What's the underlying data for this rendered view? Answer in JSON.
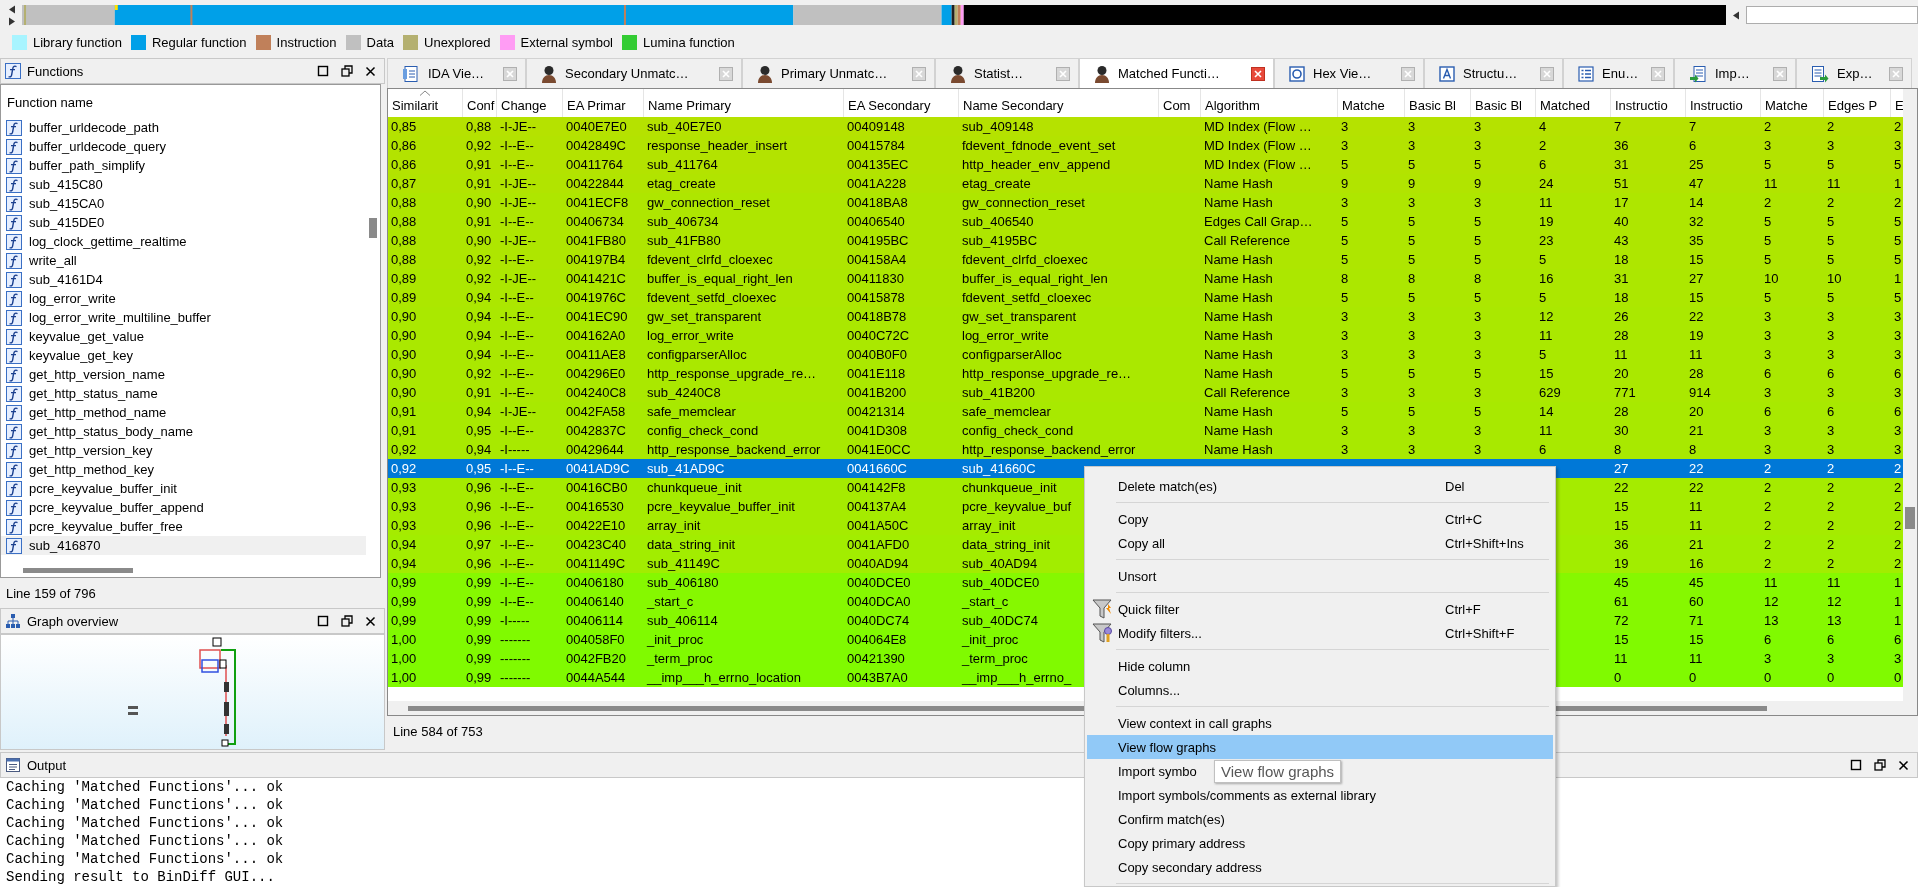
{
  "navigation_band": {
    "legend": [
      {
        "label": "Library function",
        "color": "#a8f4ff"
      },
      {
        "label": "Regular function",
        "color": "#00a0e8"
      },
      {
        "label": "Instruction",
        "color": "#c0805a"
      },
      {
        "label": "Data",
        "color": "#c0c0c0"
      },
      {
        "label": "Unexplored",
        "color": "#b4b070"
      },
      {
        "label": "External symbol",
        "color": "#ff9cf4"
      },
      {
        "label": "Lumina function",
        "color": "#33cc33"
      }
    ]
  },
  "functions_panel": {
    "title": "Functions",
    "column": "Function name",
    "items": [
      {
        "name": "buffer_urldecode_path",
        "selected": false
      },
      {
        "name": "buffer_urldecode_query",
        "selected": false
      },
      {
        "name": "buffer_path_simplify",
        "selected": false
      },
      {
        "name": "sub_415C80",
        "selected": false
      },
      {
        "name": "sub_415CA0",
        "selected": false
      },
      {
        "name": "sub_415DE0",
        "selected": false
      },
      {
        "name": "log_clock_gettime_realtime",
        "selected": false
      },
      {
        "name": "write_all",
        "selected": false
      },
      {
        "name": "sub_4161D4",
        "selected": false
      },
      {
        "name": "log_error_write",
        "selected": false
      },
      {
        "name": "log_error_write_multiline_buffer",
        "selected": false
      },
      {
        "name": "keyvalue_get_value",
        "selected": false
      },
      {
        "name": "keyvalue_get_key",
        "selected": false
      },
      {
        "name": "get_http_version_name",
        "selected": false
      },
      {
        "name": "get_http_status_name",
        "selected": false
      },
      {
        "name": "get_http_method_name",
        "selected": false
      },
      {
        "name": "get_http_status_body_name",
        "selected": false
      },
      {
        "name": "get_http_version_key",
        "selected": false
      },
      {
        "name": "get_http_method_key",
        "selected": false
      },
      {
        "name": "pcre_keyvalue_buffer_init",
        "selected": false
      },
      {
        "name": "pcre_keyvalue_buffer_append",
        "selected": false
      },
      {
        "name": "pcre_keyvalue_buffer_free",
        "selected": false
      },
      {
        "name": "sub_416870",
        "selected": true
      }
    ],
    "status": "Line 159 of 796"
  },
  "graph_overview": {
    "title": "Graph overview"
  },
  "tabs": [
    {
      "label": "IDA Vie…",
      "kind": "listing",
      "selected": false
    },
    {
      "label": "Secondary Unmatc…",
      "kind": "figure",
      "selected": false
    },
    {
      "label": "Primary Unmatc…",
      "kind": "figure",
      "selected": false
    },
    {
      "label": "Statist…",
      "kind": "figure",
      "selected": false
    },
    {
      "label": "Matched Functi…",
      "kind": "figure",
      "selected": true
    },
    {
      "label": "Hex Vie…",
      "kind": "hex",
      "selected": false
    },
    {
      "label": "Structu…",
      "kind": "struct",
      "selected": false
    },
    {
      "label": "Enu…",
      "kind": "enum",
      "selected": false
    },
    {
      "label": "Imp…",
      "kind": "import",
      "selected": false
    },
    {
      "label": "Exp…",
      "kind": "export",
      "selected": false
    }
  ],
  "table": {
    "columns": [
      {
        "label": "Similarit",
        "sorted": true
      },
      {
        "label": "Conf",
        "sorted": false
      },
      {
        "label": "Change",
        "sorted": false
      },
      {
        "label": "EA Primar",
        "sorted": false
      },
      {
        "label": "Name Primary",
        "sorted": false
      },
      {
        "label": "EA Secondary",
        "sorted": false
      },
      {
        "label": "Name Secondary",
        "sorted": false
      },
      {
        "label": "Com",
        "sorted": false
      },
      {
        "label": "Algorithm",
        "sorted": false
      },
      {
        "label": "Matche",
        "sorted": false
      },
      {
        "label": "Basic Bl",
        "sorted": false
      },
      {
        "label": "Basic Bl",
        "sorted": false
      },
      {
        "label": "Matched",
        "sorted": false
      },
      {
        "label": "Instructio",
        "sorted": false
      },
      {
        "label": "Instructio",
        "sorted": false
      },
      {
        "label": "Matche",
        "sorted": false
      },
      {
        "label": "Edges P",
        "sorted": false
      },
      {
        "label": "E",
        "sorted": false
      }
    ],
    "rows": [
      {
        "selected": false,
        "color": "#b5e200",
        "cells": [
          "0,85",
          "0,88",
          "-I-JE--",
          "0040E7E0",
          "sub_40E7E0",
          "00409148",
          "sub_409148",
          null,
          "MD Index (Flow …",
          "3",
          "3",
          "3",
          "4",
          "7",
          "7",
          "2",
          "2",
          "2"
        ]
      },
      {
        "selected": false,
        "color": "#b3e300",
        "cells": [
          "0,86",
          "0,92",
          "-I--E--",
          "0042849C",
          "response_header_insert",
          "00415784",
          "fdevent_fdnode_event_set",
          null,
          "MD Index (Flow …",
          "3",
          "3",
          "3",
          "2",
          "36",
          "6",
          "3",
          "3",
          "3"
        ]
      },
      {
        "selected": false,
        "color": "#b3e300",
        "cells": [
          "0,86",
          "0,91",
          "-I--E--",
          "00411764",
          "sub_411764",
          "004135EC",
          "http_header_env_append",
          null,
          "MD Index (Flow …",
          "5",
          "5",
          "5",
          "6",
          "31",
          "25",
          "5",
          "5",
          "5"
        ]
      },
      {
        "selected": false,
        "color": "#b1e400",
        "cells": [
          "0,87",
          "0,91",
          "-I-JE--",
          "00422844",
          "etag_create",
          "0041A228",
          "etag_create",
          null,
          "Name Hash",
          "9",
          "9",
          "9",
          "24",
          "51",
          "47",
          "11",
          "11",
          "1"
        ]
      },
      {
        "selected": false,
        "color": "#aee600",
        "cells": [
          "0,88",
          "0,90",
          "-I-JE--",
          "0041ECF8",
          "gw_connection_reset",
          "00418BA8",
          "gw_connection_reset",
          null,
          "Name Hash",
          "3",
          "3",
          "3",
          "11",
          "17",
          "14",
          "2",
          "2",
          "2"
        ]
      },
      {
        "selected": false,
        "color": "#aee600",
        "cells": [
          "0,88",
          "0,91",
          "-I--E--",
          "00406734",
          "sub_406734",
          "00406540",
          "sub_406540",
          null,
          "Edges Call Grap…",
          "5",
          "5",
          "5",
          "19",
          "40",
          "32",
          "5",
          "5",
          "5"
        ]
      },
      {
        "selected": false,
        "color": "#aee600",
        "cells": [
          "0,88",
          "0,90",
          "-I-JE--",
          "0041FB80",
          "sub_41FB80",
          "004195BC",
          "sub_4195BC",
          null,
          "Call Reference",
          "5",
          "5",
          "5",
          "23",
          "43",
          "35",
          "5",
          "5",
          "5"
        ]
      },
      {
        "selected": false,
        "color": "#aee600",
        "cells": [
          "0,88",
          "0,92",
          "-I--E--",
          "004197B4",
          "fdevent_clrfd_cloexec",
          "004158A4",
          "fdevent_clrfd_cloexec",
          null,
          "Name Hash",
          "5",
          "5",
          "5",
          "5",
          "18",
          "15",
          "5",
          "5",
          "5"
        ]
      },
      {
        "selected": false,
        "color": "#ace700",
        "cells": [
          "0,89",
          "0,92",
          "-I-JE--",
          "0041421C",
          "buffer_is_equal_right_len",
          "00411830",
          "buffer_is_equal_right_len",
          null,
          "Name Hash",
          "8",
          "8",
          "8",
          "16",
          "31",
          "27",
          "10",
          "10",
          "1"
        ]
      },
      {
        "selected": false,
        "color": "#ace700",
        "cells": [
          "0,89",
          "0,94",
          "-I--E--",
          "0041976C",
          "fdevent_setfd_cloexec",
          "00415878",
          "fdevent_setfd_cloexec",
          null,
          "Name Hash",
          "5",
          "5",
          "5",
          "5",
          "18",
          "15",
          "5",
          "5",
          "5"
        ]
      },
      {
        "selected": false,
        "color": "#aae800",
        "cells": [
          "0,90",
          "0,94",
          "-I--E--",
          "0041EC90",
          "gw_set_transparent",
          "00418B78",
          "gw_set_transparent",
          null,
          "Name Hash",
          "3",
          "3",
          "3",
          "12",
          "26",
          "22",
          "3",
          "3",
          "3"
        ]
      },
      {
        "selected": false,
        "color": "#aae800",
        "cells": [
          "0,90",
          "0,94",
          "-I--E--",
          "004162A0",
          "log_error_write",
          "0040C72C",
          "log_error_write",
          null,
          "Name Hash",
          "3",
          "3",
          "3",
          "11",
          "28",
          "19",
          "3",
          "3",
          "3"
        ]
      },
      {
        "selected": false,
        "color": "#aae800",
        "cells": [
          "0,90",
          "0,94",
          "-I--E--",
          "00411AE8",
          "configparserAlloc",
          "0040B0F0",
          "configparserAlloc",
          null,
          "Name Hash",
          "3",
          "3",
          "3",
          "5",
          "11",
          "11",
          "3",
          "3",
          "3"
        ]
      },
      {
        "selected": false,
        "color": "#aae800",
        "cells": [
          "0,90",
          "0,92",
          "-I--E--",
          "004296E0",
          "http_response_upgrade_re…",
          "0041E118",
          "http_response_upgrade_re…",
          null,
          "Name Hash",
          "5",
          "5",
          "5",
          "15",
          "20",
          "28",
          "6",
          "6",
          "6"
        ]
      },
      {
        "selected": false,
        "color": "#aae800",
        "cells": [
          "0,90",
          "0,91",
          "-I--E--",
          "004240C8",
          "sub_4240C8",
          "0041B200",
          "sub_41B200",
          null,
          "Call Reference",
          "3",
          "3",
          "3",
          "629",
          "771",
          "914",
          "3",
          "3",
          "3"
        ]
      },
      {
        "selected": false,
        "color": "#a8e900",
        "cells": [
          "0,91",
          "0,94",
          "-I-JE--",
          "0042FA58",
          "safe_memclear",
          "00421314",
          "safe_memclear",
          null,
          "Name Hash",
          "5",
          "5",
          "5",
          "14",
          "28",
          "20",
          "6",
          "6",
          "6"
        ]
      },
      {
        "selected": false,
        "color": "#a8e900",
        "cells": [
          "0,91",
          "0,95",
          "-I--E--",
          "0042837C",
          "config_check_cond",
          "0041D308",
          "config_check_cond",
          null,
          "Name Hash",
          "3",
          "3",
          "3",
          "11",
          "30",
          "21",
          "3",
          "3",
          "3"
        ]
      },
      {
        "selected": false,
        "color": "#a8e900",
        "cells": [
          "0,92",
          "0,94",
          "-I-----",
          "00429644",
          "http_response_backend_error",
          "0041E0CC",
          "http_response_backend_error",
          null,
          "Name Hash",
          "3",
          "3",
          "3",
          "6",
          "8",
          "8",
          "3",
          "3",
          "3"
        ]
      },
      {
        "selected": true,
        "cells": [
          "0,92",
          "0,95",
          "-I--E--",
          "0041AD9C",
          "sub_41AD9C",
          "0041660C",
          "sub_41660C",
          null,
          null,
          null,
          null,
          null,
          null,
          "27",
          "22",
          "2",
          "2",
          "2"
        ]
      },
      {
        "selected": false,
        "color": "#a5eb00",
        "cells": [
          "0,93",
          "0,96",
          "-I--E--",
          "00416CB0",
          "chunkqueue_init",
          "004142F8",
          "chunkqueue_init",
          null,
          null,
          null,
          null,
          null,
          null,
          "22",
          "22",
          "2",
          "2",
          "2"
        ]
      },
      {
        "selected": false,
        "color": "#a5eb00",
        "cells": [
          "0,93",
          "0,96",
          "-I--E--",
          "00416530",
          "pcre_keyvalue_buffer_init",
          "004137A4",
          "pcre_keyvalue_buf",
          null,
          null,
          null,
          null,
          null,
          null,
          "15",
          "11",
          "2",
          "2",
          "2"
        ]
      },
      {
        "selected": false,
        "color": "#a5eb00",
        "cells": [
          "0,93",
          "0,96",
          "-I--E--",
          "00422E10",
          "array_init",
          "0041A50C",
          "array_init",
          null,
          null,
          null,
          null,
          null,
          null,
          "15",
          "11",
          "2",
          "2",
          "2"
        ]
      },
      {
        "selected": false,
        "color": "#a2ed00",
        "cells": [
          "0,94",
          "0,97",
          "-I--E--",
          "00423C40",
          "data_string_init",
          "0041AFD0",
          "data_string_init",
          null,
          null,
          null,
          null,
          null,
          null,
          "36",
          "21",
          "2",
          "2",
          "2"
        ]
      },
      {
        "selected": false,
        "color": "#a2ed00",
        "cells": [
          "0,94",
          "0,96",
          "-I--E--",
          "0041149C",
          "sub_41149C",
          "0040AD94",
          "sub_40AD94",
          null,
          null,
          null,
          null,
          null,
          null,
          "19",
          "16",
          "2",
          "2",
          "2"
        ]
      },
      {
        "selected": false,
        "color": "#86f800",
        "cells": [
          "0,99",
          "0,99",
          "-I--E--",
          "00406180",
          "sub_406180",
          "0040DCE0",
          "sub_40DCE0",
          null,
          null,
          null,
          null,
          null,
          null,
          "45",
          "45",
          "11",
          "11",
          "1"
        ]
      },
      {
        "selected": false,
        "color": "#86f800",
        "cells": [
          "0,99",
          "0,99",
          "-I--E--",
          "00406140",
          "_start_c",
          "0040DCA0",
          "_start_c",
          null,
          null,
          null,
          null,
          null,
          null,
          "61",
          "60",
          "12",
          "12",
          "1"
        ]
      },
      {
        "selected": false,
        "color": "#86f800",
        "cells": [
          "0,99",
          "0,99",
          "-I-----",
          "00406114",
          "sub_406114",
          "0040DC74",
          "sub_40DC74",
          null,
          null,
          null,
          null,
          null,
          null,
          "72",
          "71",
          "13",
          "13",
          "1"
        ]
      },
      {
        "selected": false,
        "color": "#80fa00",
        "cells": [
          "1,00",
          "0,99",
          "-------",
          "004058F0",
          "_init_proc",
          "004064E8",
          "_init_proc",
          null,
          null,
          null,
          null,
          null,
          null,
          "15",
          "15",
          "6",
          "6",
          "6"
        ]
      },
      {
        "selected": false,
        "color": "#80fa00",
        "cells": [
          "1,00",
          "0,99",
          "-------",
          "0042FB20",
          "_term_proc",
          "00421390",
          "_term_proc",
          null,
          null,
          null,
          null,
          null,
          null,
          "11",
          "11",
          "3",
          "3",
          "3"
        ]
      },
      {
        "selected": false,
        "color": "#80fa00",
        "cells": [
          "1,00",
          "0,99",
          "-------",
          "0044A544",
          "__imp___h_errno_location",
          "0043B7A0",
          "__imp___h_errno_",
          null,
          null,
          null,
          null,
          null,
          null,
          "0",
          "0",
          "0",
          "0",
          "0"
        ]
      }
    ],
    "status": "Line 584 of 753"
  },
  "output": {
    "title": "Output",
    "lines": [
      "Caching 'Matched Functions'... ok",
      "Caching 'Matched Functions'... ok",
      "Caching 'Matched Functions'... ok",
      "Caching 'Matched Functions'... ok",
      "Caching 'Matched Functions'... ok",
      "Sending result to BinDiff GUI..."
    ]
  },
  "context_menu": {
    "items": [
      {
        "kind": "item",
        "label": "Delete match(es)",
        "shortcut": "Del",
        "selected": false
      },
      {
        "kind": "separator"
      },
      {
        "kind": "item",
        "label": "Copy",
        "shortcut": "Ctrl+C",
        "selected": false
      },
      {
        "kind": "item",
        "label": "Copy all",
        "shortcut": "Ctrl+Shift+Ins",
        "selected": false
      },
      {
        "kind": "separator"
      },
      {
        "kind": "item",
        "label": "Unsort",
        "selected": false
      },
      {
        "kind": "separator"
      },
      {
        "kind": "funnel-item",
        "label": "Quick filter",
        "shortcut": "Ctrl+F",
        "selected": false
      },
      {
        "kind": "funnel-gear-item",
        "label": "Modify filters...",
        "shortcut": "Ctrl+Shift+F",
        "selected": false
      },
      {
        "kind": "separator"
      },
      {
        "kind": "item",
        "label": "Hide column",
        "selected": false
      },
      {
        "kind": "item",
        "label": "Columns...",
        "selected": false
      },
      {
        "kind": "separator"
      },
      {
        "kind": "item",
        "label": "View context in call graphs",
        "selected": false
      },
      {
        "kind": "item",
        "label": "View flow graphs",
        "selected": true
      },
      {
        "kind": "item",
        "label": "Import symbo",
        "selected": false
      },
      {
        "kind": "item",
        "label": "Import symbols/comments as external library",
        "selected": false
      },
      {
        "kind": "item",
        "label": "Confirm match(es)",
        "selected": false
      },
      {
        "kind": "item",
        "label": "Copy primary address",
        "selected": false
      },
      {
        "kind": "item",
        "label": "Copy secondary address",
        "selected": false
      },
      {
        "kind": "separator"
      }
    ],
    "tooltip": "View flow graphs"
  }
}
